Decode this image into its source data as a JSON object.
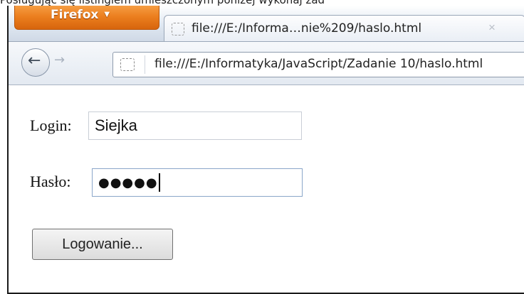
{
  "caption": "Posługując się listingiem umieszczonym poniżej wykonaj zad",
  "browser": {
    "menu_button": "Firefox",
    "tab": {
      "title": "file:///E:/Informa…nie%209/haslo.html",
      "close": "×"
    },
    "nav": {
      "back_glyph": "←",
      "forward_glyph": "→",
      "url": "file:///E:/Informatyka/JavaScript/Zadanie 10/haslo.html"
    }
  },
  "page": {
    "login_label": "Login:",
    "login_value": "Siejka",
    "password_label": "Hasło:",
    "password_mask": "●●●●●",
    "submit_label": "Logowanie..."
  }
}
